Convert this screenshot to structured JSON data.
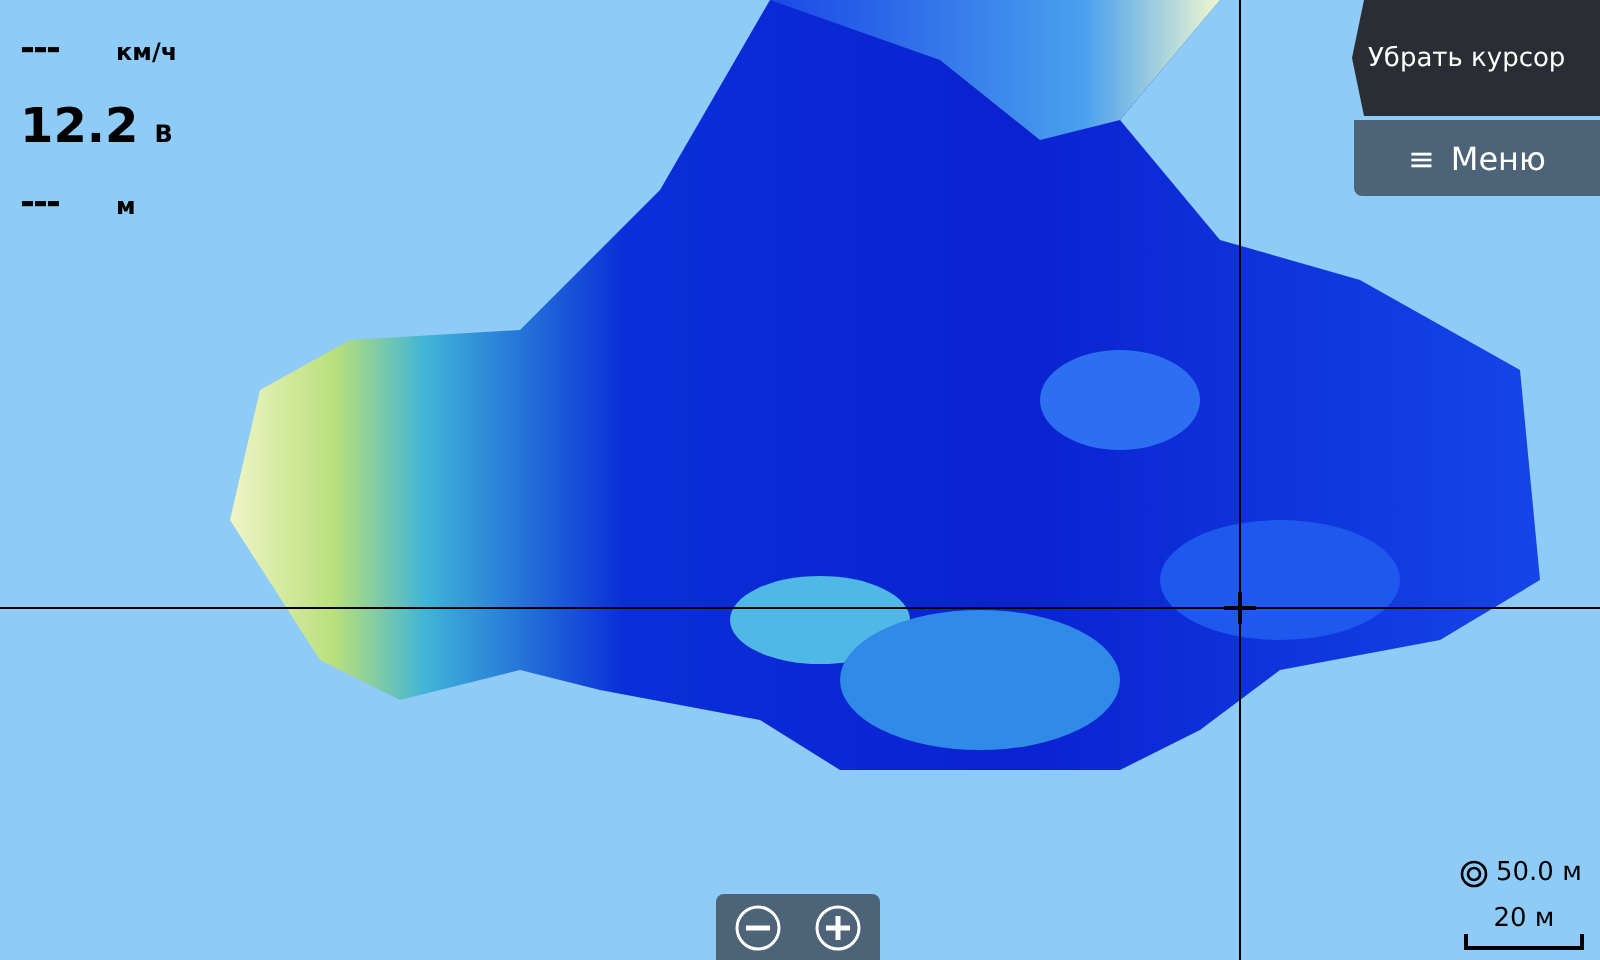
{
  "readouts": [
    {
      "value": "---",
      "unit": "км/ч",
      "kind": "dash"
    },
    {
      "value": "12.2",
      "unit": "В",
      "kind": "number"
    },
    {
      "value": "---",
      "unit": "м",
      "kind": "dash"
    }
  ],
  "clear_cursor_button": {
    "label": "Убрать курсор"
  },
  "menu_button": {
    "icon": "≡",
    "label": "Меню"
  },
  "zoom_buttons": [
    {
      "kind": "out"
    },
    {
      "kind": "in"
    }
  ],
  "range": {
    "label": "50.0 м"
  },
  "scale": {
    "label": "20 м"
  }
}
